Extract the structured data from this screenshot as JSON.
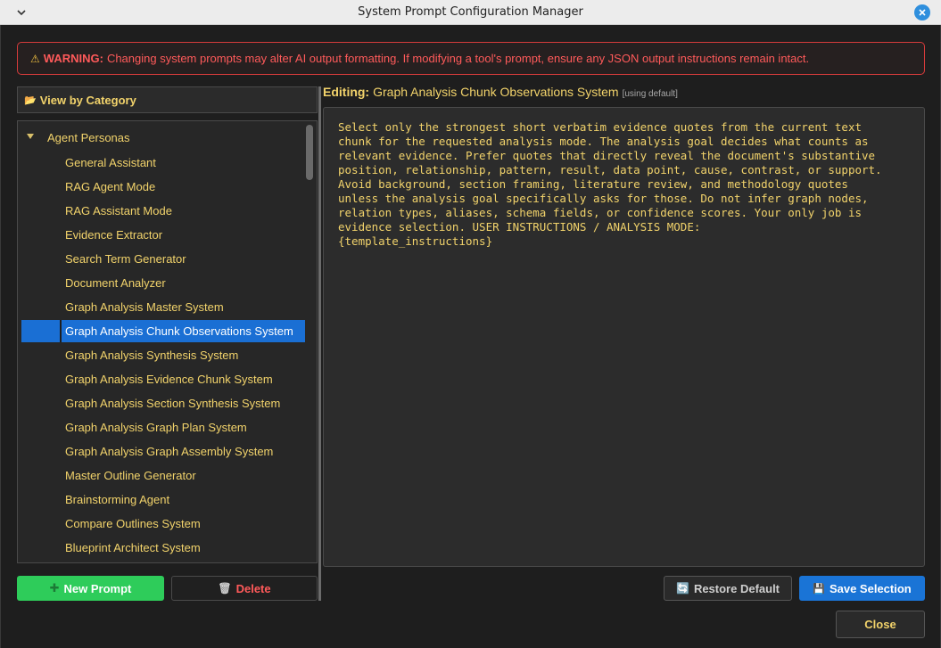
{
  "window": {
    "title": "System Prompt Configuration Manager"
  },
  "warning": {
    "label": "WARNING:",
    "text": "Changing system prompts may alter AI output formatting. If modifying a tool's prompt, ensure any JSON output instructions remain intact."
  },
  "sidebar": {
    "header": "View by Category",
    "group": "Agent Personas",
    "items": [
      "General Assistant",
      "RAG Agent Mode",
      "RAG Assistant Mode",
      "Evidence Extractor",
      "Search Term Generator",
      "Document Analyzer",
      "Graph Analysis Master System",
      "Graph Analysis Chunk Observations System",
      "Graph Analysis Synthesis System",
      "Graph Analysis Evidence Chunk System",
      "Graph Analysis Section Synthesis System",
      "Graph Analysis Graph Plan System",
      "Graph Analysis Graph Assembly System",
      "Master Outline Generator",
      "Brainstorming Agent",
      "Compare Outlines System",
      "Blueprint Architect System"
    ],
    "selected": "Graph Analysis Chunk Observations System"
  },
  "editor": {
    "label": "Editing:",
    "prompt_name": "Graph Analysis Chunk Observations System",
    "status": "[using default]",
    "content": "Select only the strongest short verbatim evidence quotes from the current text\nchunk for the requested analysis mode. The analysis goal decides what counts as\nrelevant evidence. Prefer quotes that directly reveal the document's substantive\nposition, relationship, pattern, result, data point, cause, contrast, or support.\nAvoid background, section framing, literature review, and methodology quotes\nunless the analysis goal specifically asks for those. Do not infer graph nodes,\nrelation types, aliases, schema fields, or confidence scores. Your only job is\nevidence selection. USER INSTRUCTIONS / ANALYSIS MODE:\n{template_instructions}"
  },
  "buttons": {
    "new_prompt": "New Prompt",
    "delete": "Delete",
    "restore_default": "Restore Default",
    "save_selection": "Save Selection",
    "close": "Close"
  },
  "colors": {
    "accent_yellow": "#f2d36b",
    "selection_blue": "#1a6fd4",
    "warning_red": "#ff5a5a",
    "new_green": "#2ecc5a",
    "save_blue": "#1a74d6"
  }
}
